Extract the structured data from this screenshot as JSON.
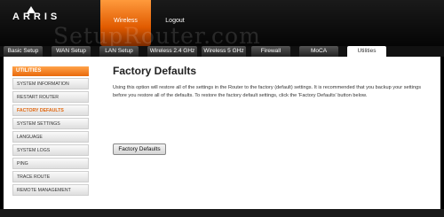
{
  "header": {
    "logo_text": "ARRIS",
    "nav": [
      {
        "label": "Wireless",
        "active": true
      },
      {
        "label": "Logout",
        "active": false
      }
    ]
  },
  "watermark": "SetupRouter.com",
  "tabs": [
    {
      "label": "Basic Setup",
      "active": false
    },
    {
      "label": "WAN Setup",
      "active": false
    },
    {
      "label": "LAN Setup",
      "active": false
    },
    {
      "label": "Wireless 2.4 GHz",
      "active": false
    },
    {
      "label": "Wireless 5 GHz",
      "active": false
    },
    {
      "label": "Firewall",
      "active": false
    },
    {
      "label": "MoCA",
      "active": false
    },
    {
      "label": "Utilities",
      "active": true
    }
  ],
  "sidebar": {
    "heading": "UTILITIES",
    "items": [
      {
        "label": "SYSTEM INFORMATION",
        "active": false
      },
      {
        "label": "RESTART ROUTER",
        "active": false
      },
      {
        "label": "FACTORY DEFAULTS",
        "active": true
      },
      {
        "label": "SYSTEM SETTINGS",
        "active": false
      },
      {
        "label": "LANGUAGE",
        "active": false
      },
      {
        "label": "SYSTEM LOGS",
        "active": false
      },
      {
        "label": "PING",
        "active": false
      },
      {
        "label": "TRACE ROUTE",
        "active": false
      },
      {
        "label": "REMOTE MANAGEMENT",
        "active": false
      }
    ]
  },
  "main": {
    "title": "Factory Defaults",
    "description": "Using this option will restore all of the settings in the Router to the factory (default) settings. It is recommended that you backup your settings before you restore all of the defaults. To restore the factory default settings, click the 'Factory Defaults' button below.",
    "button_label": "Factory Defaults"
  },
  "colors": {
    "accent": "#e8690c",
    "header_bg": "#0a0a0a"
  }
}
